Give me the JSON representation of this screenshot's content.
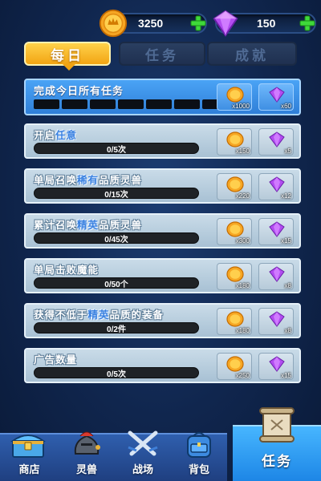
{
  "currency": {
    "coins": "3250",
    "gems": "150",
    "coin_icon": "coin-icon",
    "gem_icon": "gem-icon",
    "add_icon": "plus-icon"
  },
  "tabs": [
    {
      "label": "每日",
      "active": true
    },
    {
      "label": "任务",
      "active": false
    },
    {
      "label": "成就",
      "active": false
    }
  ],
  "highlight_quest": {
    "title": "完成今日所有任务",
    "segments_total": 7,
    "rewards": [
      {
        "icon": "coin-icon",
        "qty": "x1000"
      },
      {
        "icon": "gem-icon",
        "qty": "x60"
      }
    ]
  },
  "quests": [
    {
      "title_pre": "开启",
      "title_hl": "任意",
      "title_post": "",
      "progress": "0/5次",
      "coin_qty": "x150",
      "gem_qty": "x5"
    },
    {
      "title_pre": "单局召唤",
      "title_hl": "稀有",
      "title_post": "品质灵兽",
      "progress": "0/15次",
      "coin_qty": "x220",
      "gem_qty": "x12"
    },
    {
      "title_pre": "累计召唤",
      "title_hl": "精英",
      "title_post": "品质灵兽",
      "progress": "0/45次",
      "coin_qty": "x300",
      "gem_qty": "x15"
    },
    {
      "title_pre": "单局击败魔能",
      "title_hl": "",
      "title_post": "",
      "progress": "0/50个",
      "coin_qty": "x180",
      "gem_qty": "x8"
    },
    {
      "title_pre": "获得不低于",
      "title_hl": "精英",
      "title_post": "品质的装备",
      "progress": "0/2件",
      "coin_qty": "x180",
      "gem_qty": "x8"
    },
    {
      "title_pre": "广告数量",
      "title_hl": "",
      "title_post": "",
      "progress": "0/5次",
      "coin_qty": "x250",
      "gem_qty": "x15"
    }
  ],
  "nav": [
    {
      "label": "商店",
      "icon": "treasure-chest-icon"
    },
    {
      "label": "灵兽",
      "icon": "knight-beast-icon"
    },
    {
      "label": "战场",
      "icon": "crossed-swords-icon"
    },
    {
      "label": "背包",
      "icon": "backpack-icon"
    },
    {
      "label": "任务",
      "icon": "scroll-icon",
      "active": true
    }
  ],
  "colors": {
    "background": "#10264e",
    "active_tab": "#f2a413",
    "highlight_card": "#3f8fe3",
    "quest_card": "#b6cad9",
    "keyword_highlight": "#3b82e0",
    "active_nav": "#2b9af0"
  }
}
